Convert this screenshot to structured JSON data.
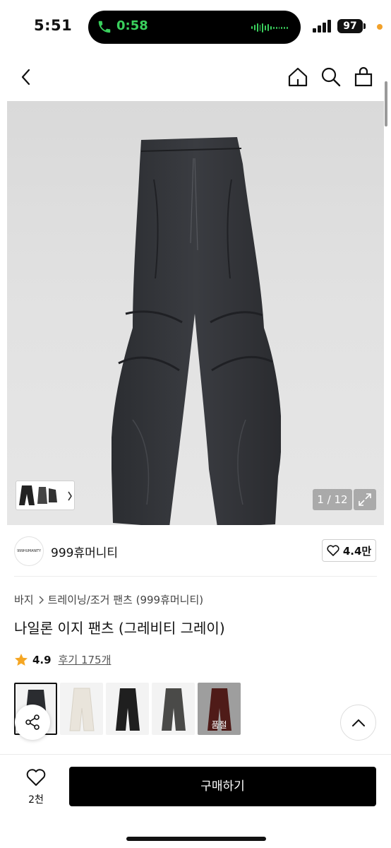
{
  "status_bar": {
    "time": "5:51",
    "call_duration": "0:58",
    "battery": "97",
    "icons": [
      "phone-icon",
      "signal-icon",
      "battery-icon"
    ]
  },
  "nav": {
    "icons": [
      "back-icon",
      "home-icon",
      "search-icon",
      "bag-icon"
    ]
  },
  "gallery": {
    "counter": "1 / 12",
    "thumbnail_strip_icon": "chevron-right-icon",
    "expand_icon": "expand-icon"
  },
  "brand": {
    "logo_text": "999HUMANITY",
    "name": "999휴머니티",
    "like_count": "4.4만"
  },
  "product": {
    "breadcrumb": [
      "바지",
      "트레이닝/조거 팬츠 (999휴머니티)"
    ],
    "title": "나일론 이지 팬츠 (그레비티 그레이)",
    "rating": "4.9",
    "review_label": "후기 175개"
  },
  "swatches": [
    {
      "color": "#2a2c30",
      "selected": true,
      "label": ""
    },
    {
      "color": "#e9e4db",
      "selected": false,
      "label": ""
    },
    {
      "color": "#1f1f1f",
      "selected": false,
      "label": ""
    },
    {
      "color": "#4a4a48",
      "selected": false,
      "label": ""
    },
    {
      "color": "#7a2a26",
      "selected": false,
      "label": "품절"
    }
  ],
  "bottom_bar": {
    "wish_count": "2천",
    "buy_label": "구매하기"
  },
  "colors": {
    "accent": "#000000",
    "star": "#f5a623",
    "call_green": "#3ad05d"
  }
}
